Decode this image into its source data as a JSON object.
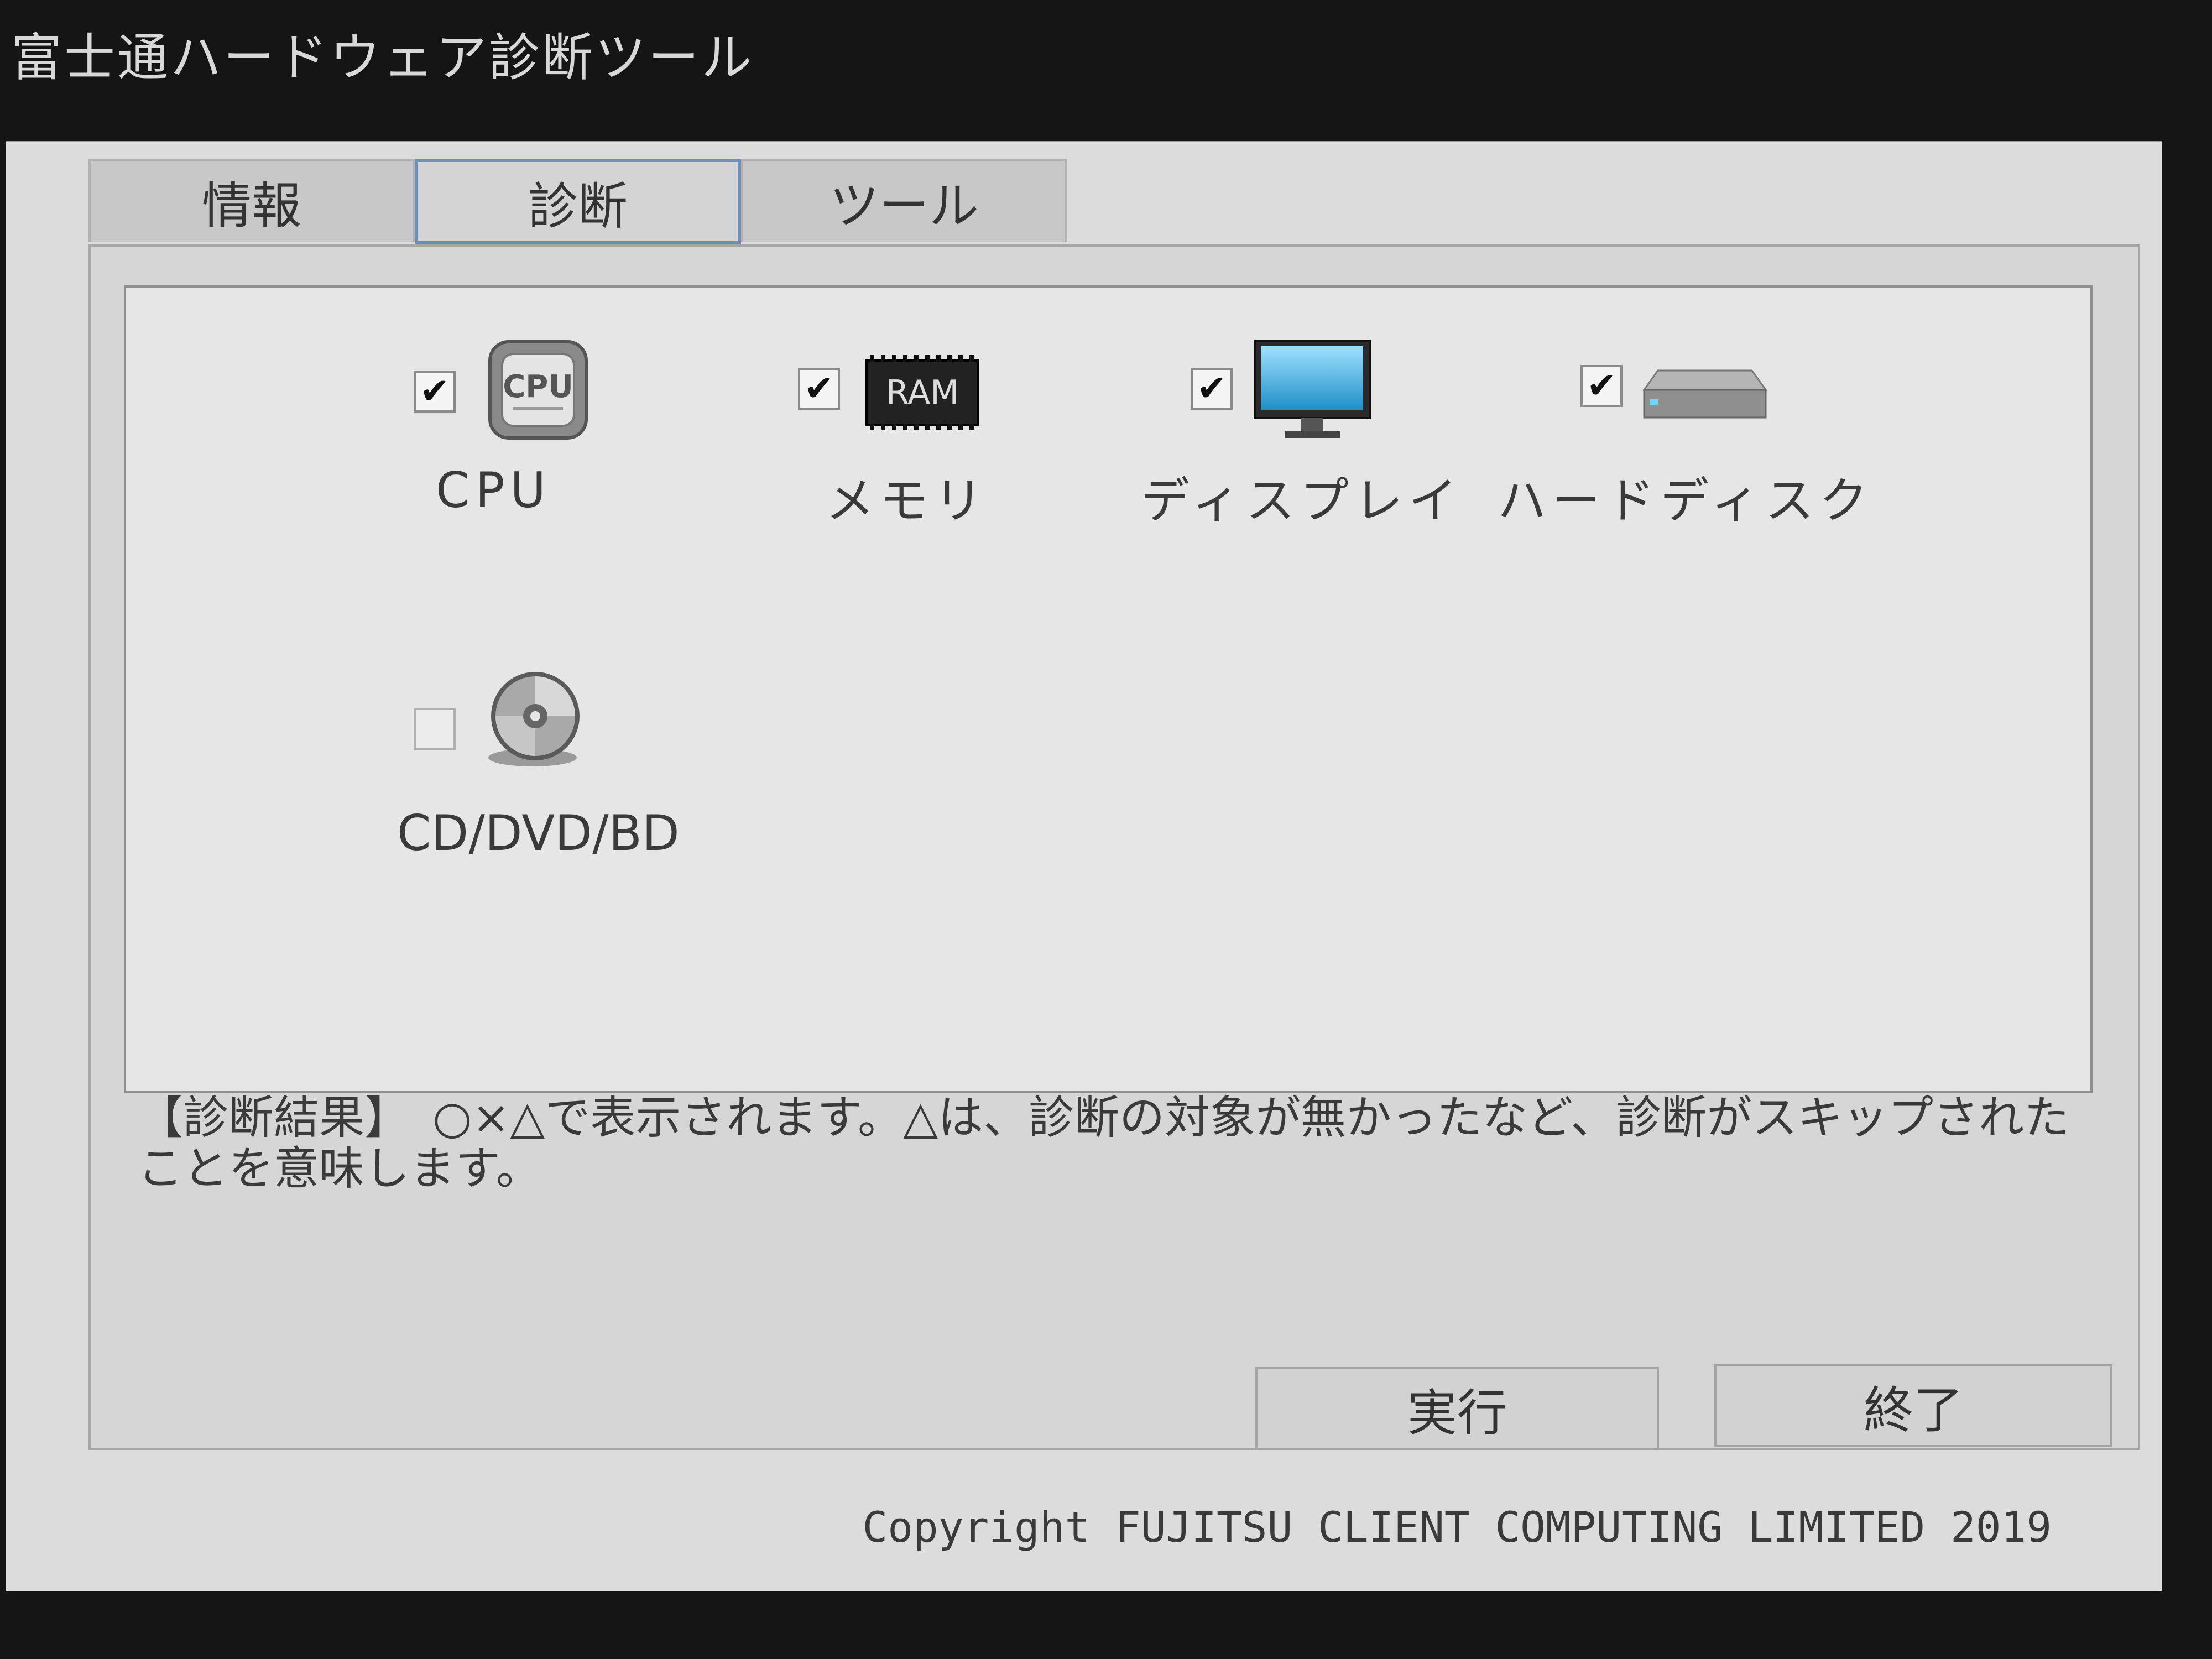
{
  "app": {
    "title": "富士通ハードウェア診断ツール"
  },
  "tabs": [
    {
      "label": "情報",
      "active": false
    },
    {
      "label": "診断",
      "active": true
    },
    {
      "label": "ツール",
      "active": false
    }
  ],
  "devices": [
    {
      "label": "CPU",
      "checked": true,
      "icon": "cpu-icon",
      "icon_text": "CPU",
      "mark": "✔"
    },
    {
      "label": "メモリ",
      "checked": true,
      "icon": "ram-icon",
      "icon_text": "RAM",
      "mark": "✔"
    },
    {
      "label": "ディスプレイ",
      "checked": true,
      "icon": "monitor-icon",
      "mark": "✔"
    },
    {
      "label": "ハードディスク",
      "checked": true,
      "icon": "hard-disk-icon",
      "mark": "✔"
    },
    {
      "label": "CD/DVD/BD",
      "checked": false,
      "icon": "optical-disc-icon",
      "mark": ""
    }
  ],
  "result": {
    "text": "【診断結果】　○×△で表示されます。△は、診断の対象が無かったなど、診断がスキップされたことを意味します。"
  },
  "buttons": {
    "run_label": "実行",
    "exit_label": "終了"
  },
  "footer": {
    "copyright": "Copyright FUJITSU CLIENT COMPUTING LIMITED 2019"
  },
  "colors": {
    "active_tab_border": "#6f8fb8",
    "window_bg": "#dcdcdc",
    "panel_bg": "#e6e6e6"
  }
}
